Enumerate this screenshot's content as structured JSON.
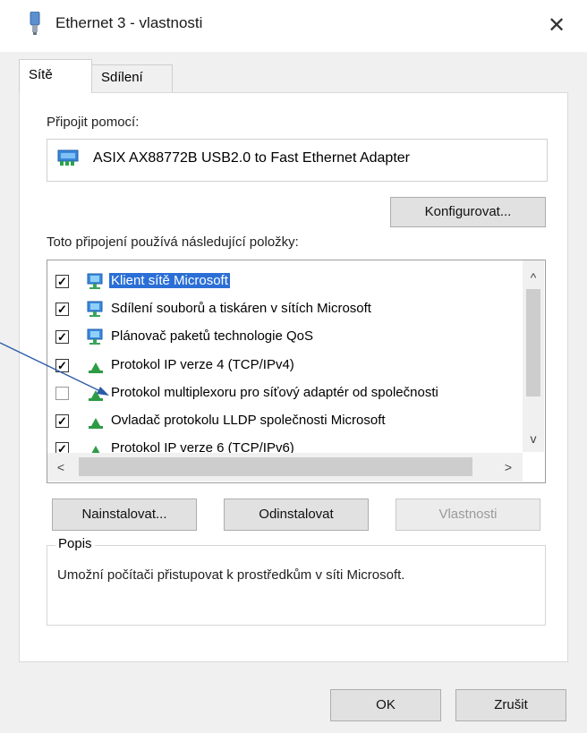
{
  "window": {
    "title": "Ethernet 3 - vlastnosti",
    "close": "✕"
  },
  "tabs": [
    {
      "label": "Sítě",
      "active": true
    },
    {
      "label": "Sdílení",
      "active": false
    }
  ],
  "connect": {
    "label": "Připojit pomocí:",
    "adapter": "ASIX AX88772B USB2.0 to Fast Ethernet Adapter",
    "configure_label": "Konfigurovat..."
  },
  "items": {
    "label": "Toto připojení používá následující položky:",
    "list": [
      {
        "label": "Klient sítě Microsoft",
        "checked": true,
        "icon": "network-icon",
        "selected": true
      },
      {
        "label": "Sdílení souborů a tiskáren v sítích Microsoft",
        "checked": true,
        "icon": "network-icon",
        "selected": false
      },
      {
        "label": "Plánovač paketů technologie QoS",
        "checked": true,
        "icon": "network-icon",
        "selected": false
      },
      {
        "label": "Protokol IP verze 4 (TCP/IPv4)",
        "checked": true,
        "icon": "protocol-icon",
        "selected": false
      },
      {
        "label": "Protokol multiplexoru pro síťový adaptér od společnosti",
        "checked": false,
        "icon": "protocol-icon",
        "selected": false
      },
      {
        "label": "Ovladač protokolu LLDP společnosti Microsoft",
        "checked": true,
        "icon": "protocol-icon",
        "selected": false
      },
      {
        "label": "Protokol IP verze 6 (TCP/IPv6)",
        "checked": true,
        "icon": "protocol-icon",
        "selected": false
      }
    ],
    "scroll_up": "^",
    "scroll_down": "v",
    "scroll_left": "<",
    "scroll_right": ">"
  },
  "actions": {
    "install": "Nainstalovat...",
    "uninstall": "Odinstalovat",
    "properties": "Vlastnosti"
  },
  "description": {
    "label": "Popis",
    "text": "Umožní počítači přistupovat k prostředkům v síti Microsoft."
  },
  "footer": {
    "ok": "OK",
    "cancel": "Zrušit"
  },
  "colors": {
    "accent": "#2c7cd6",
    "selection": "#2b6fd6",
    "pointer": "#2a5aa8"
  }
}
